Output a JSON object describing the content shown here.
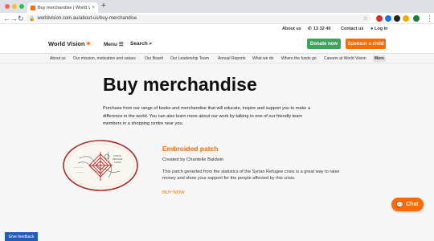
{
  "browser": {
    "tab_title": "Buy merchandise | World Vision",
    "tab_close": "×",
    "new_tab": "+",
    "back": "←",
    "forward": "→",
    "reload": "↻",
    "url": "worldvision.com.au/about-us/buy-merchandise",
    "lock_icon": "lock-icon",
    "star_icon": "star-icon",
    "menu_icon": "⋮",
    "extension_colors": [
      "#d93025",
      "#1a73e8",
      "#202124",
      "#f9ab00",
      "#188038"
    ]
  },
  "utility_bar": {
    "about": "About us",
    "phone": "13 32 40",
    "contact": "Contact us",
    "login": "Log in"
  },
  "header": {
    "logo": "World Vision",
    "menu": "Menu",
    "search": "Search",
    "donate": "Donate now",
    "sponsor": "Sponsor a child",
    "colors": {
      "orange": "#ff6b00",
      "green": "#3aa65a"
    }
  },
  "subnav": [
    "About us",
    "Our mission, motivation and values",
    "Our Board",
    "Our Leadership Team",
    "Annual Reports",
    "What we do",
    "Where the funds go",
    "Careers at World Vision",
    "More"
  ],
  "page": {
    "title": "Buy merchandise",
    "intro": "Purchase from our range of books and merchandise that will educate, inspire and support you to make a difference in the world. You can also learn more about our work by talking to one of our friendly team members in a shopping centre near you."
  },
  "product": {
    "title": "Embroided patch",
    "author": "Created by Chantelle Baldwin",
    "description": "This patch generted from the statistics of the Syrian Refugee crisis is a great way to raise money and show your support for the people affected by this crisis.",
    "cta": "BUY NOW"
  },
  "chat": {
    "label": "Chat"
  },
  "feedback": {
    "label": "Give feedback"
  }
}
